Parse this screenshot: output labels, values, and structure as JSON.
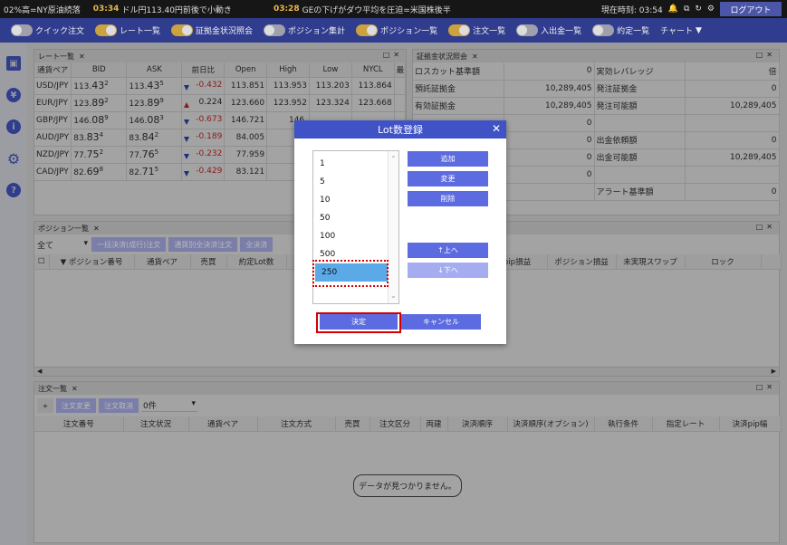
{
  "ticker": {
    "item1": "02%高=NY原油続落",
    "time2": "03:34",
    "item2": "ドル円113.40円前後で小動き",
    "time3": "03:28",
    "item3": "GEの下げがダウ平均を圧迫=米国株後半",
    "clock": "現在時刻: 03:54",
    "logout": "ログアウト"
  },
  "menu": {
    "items": [
      {
        "label": "クイック注文",
        "on": false
      },
      {
        "label": "レート一覧",
        "on": true
      },
      {
        "label": "証拠金状況照会",
        "on": true
      },
      {
        "label": "ポジション集計",
        "on": false
      },
      {
        "label": "ポジション一覧",
        "on": true
      },
      {
        "label": "注文一覧",
        "on": true
      },
      {
        "label": "入出金一覧",
        "on": false
      },
      {
        "label": "約定一覧",
        "on": false
      }
    ],
    "chart": "チャート"
  },
  "rate_panel": {
    "title": "レート一覧",
    "headers": [
      "通貨ペア",
      "BID",
      "ASK",
      "前日比",
      "Open",
      "High",
      "Low",
      "NYCL",
      "最"
    ],
    "rows": [
      {
        "pair": "USD/JPY",
        "bid_a": "113.",
        "bid_b": "43",
        "bid_c": "2",
        "ask_a": "113.",
        "ask_b": "43",
        "ask_c": "5",
        "dir": "down",
        "chg": "-0.432",
        "open": "113.851",
        "high": "113.953",
        "low": "113.203",
        "nycl": "113.864"
      },
      {
        "pair": "EUR/JPY",
        "bid_a": "123.",
        "bid_b": "89",
        "bid_c": "2",
        "ask_a": "123.",
        "ask_b": "89",
        "ask_c": "9",
        "dir": "up",
        "chg": "0.224",
        "open": "123.660",
        "high": "123.952",
        "low": "123.324",
        "nycl": "123.668"
      },
      {
        "pair": "GBP/JPY",
        "bid_a": "146.",
        "bid_b": "08",
        "bid_c": "9",
        "ask_a": "146.",
        "ask_b": "08",
        "ask_c": "3",
        "dir": "down",
        "chg": "-0.673",
        "open": "146.721",
        "high": "146.",
        "low": "",
        "nycl": ""
      },
      {
        "pair": "AUD/JPY",
        "bid_a": "83.",
        "bid_b": "83",
        "bid_c": "4",
        "ask_a": "83.",
        "ask_b": "84",
        "ask_c": "2",
        "dir": "down",
        "chg": "-0.189",
        "open": "84.005",
        "high": "84.",
        "low": "",
        "nycl": ""
      },
      {
        "pair": "NZD/JPY",
        "bid_a": "77.",
        "bid_b": "75",
        "bid_c": "2",
        "ask_a": "77.",
        "ask_b": "76",
        "ask_c": "5",
        "dir": "down",
        "chg": "-0.232",
        "open": "77.959",
        "high": "77.",
        "low": "",
        "nycl": ""
      },
      {
        "pair": "CAD/JPY",
        "bid_a": "82.",
        "bid_b": "69",
        "bid_c": "8",
        "ask_a": "82.",
        "ask_b": "71",
        "ask_c": "5",
        "dir": "down",
        "chg": "-0.429",
        "open": "83.121",
        "high": "83.",
        "low": "",
        "nycl": ""
      }
    ]
  },
  "margin_panel": {
    "title": "証拠金状況照会",
    "rows": [
      {
        "l1": "ロスカット基準額",
        "v1": "0",
        "l2": "実効レバレッジ",
        "v2": "倍"
      },
      {
        "l1": "預託証拠金",
        "v1": "10,289,405",
        "l2": "発注証拠金",
        "v2": "0"
      },
      {
        "l1": "有効証拠金",
        "v1": "10,289,405",
        "l2": "発注可能額",
        "v2": "10,289,405"
      },
      {
        "l1": "",
        "v1": "0",
        "l2": "",
        "v2": ""
      },
      {
        "l1": "",
        "v1": "0",
        "l2": "出金依頼額",
        "v2": "0"
      },
      {
        "l1": "",
        "v1": "0",
        "l2": "出金可能額",
        "v2": "10,289,405"
      },
      {
        "l1": "",
        "v1": "0",
        "l2": "",
        "v2": ""
      },
      {
        "l1": "",
        "v1": "",
        "l2": "アラート基準額",
        "v2": "0"
      }
    ]
  },
  "position_panel": {
    "title": "ポジション一覧",
    "filter": "全て",
    "btn1": "一括決済(成行)注文",
    "btn2": "通貨別全決済注文",
    "btn3": "全決済",
    "headers_left": [
      "▼ ポジション番号",
      "通貨ペア",
      "売買",
      "約定Lot数"
    ],
    "headers_right": [
      "pip損益",
      "ポジション損益",
      "未実現スワップ",
      "ロック"
    ]
  },
  "order_panel": {
    "title": "注文一覧",
    "plus": "+",
    "btn1": "注文変更",
    "btn2": "注文取消",
    "count": "0件",
    "headers": [
      "注文番号",
      "注文状況",
      "通貨ペア",
      "注文方式",
      "売買",
      "注文区分",
      "両建",
      "決済順序",
      "決済順序(オプション)",
      "執行条件",
      "指定レート",
      "決済pip幅"
    ],
    "empty": "データが見つかりません。"
  },
  "modal": {
    "title": "Lot数登録",
    "lots": [
      "1",
      "5",
      "10",
      "50",
      "100",
      "500",
      "250"
    ],
    "selected": "250",
    "add": "追加",
    "change": "変更",
    "delete": "削除",
    "up": "↑上へ",
    "down": "↓下へ",
    "ok": "決定",
    "cancel": "キャンセル"
  },
  "colors": {
    "accent": "#3f52c6",
    "menubar": "#303c8e",
    "highlight": "#d40000",
    "selected_row": "#5ba9e6"
  }
}
